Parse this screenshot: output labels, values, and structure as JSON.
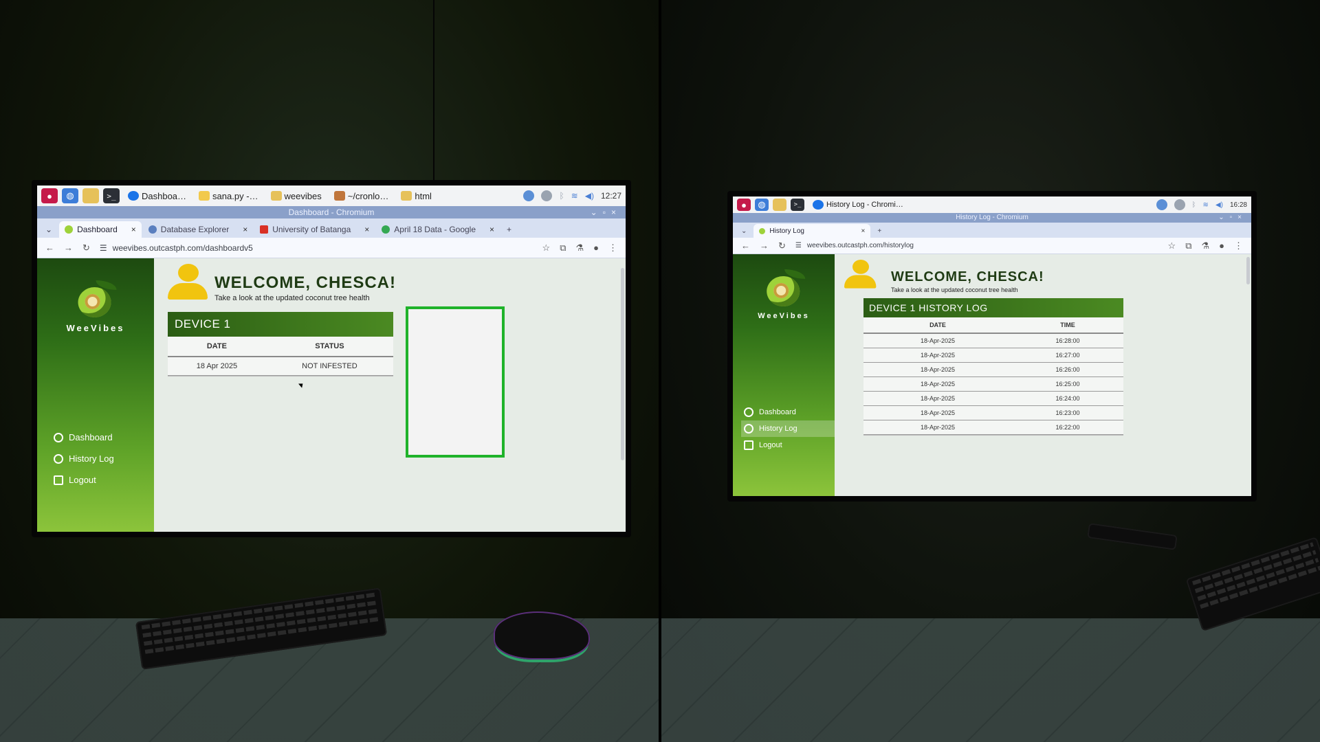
{
  "left": {
    "taskbar": {
      "tasks": [
        "Dashboa…",
        "sana.py -…",
        "weevibes",
        "~/cronlo…",
        "html"
      ],
      "clock": "12:27"
    },
    "window_title": "Dashboard - Chromium",
    "tabs": [
      {
        "label": "Dashboard",
        "active": true
      },
      {
        "label": "Database Explorer"
      },
      {
        "label": "University of Batanga"
      },
      {
        "label": "April 18 Data - Google"
      }
    ],
    "url": "weevibes.outcastph.com/dashboardv5",
    "app": {
      "logo": "WeeVibes",
      "nav": [
        "Dashboard",
        "History Log",
        "Logout"
      ],
      "welcome_title": "WELCOME, CHESCA!",
      "welcome_sub": "Take a look at the updated coconut tree health",
      "device_title": "DEVICE 1",
      "columns": [
        "DATE",
        "STATUS"
      ],
      "row": {
        "date": "18 Apr 2025",
        "status": "NOT INFESTED"
      }
    }
  },
  "right": {
    "taskbar": {
      "tasks": [
        "History Log - Chromi…"
      ],
      "clock": "16:28"
    },
    "window_title": "History Log - Chromium",
    "tabs": [
      {
        "label": "History Log",
        "active": true
      }
    ],
    "url": "weevibes.outcastph.com/historylog",
    "app": {
      "logo": "WeeVibes",
      "nav": [
        "Dashboard",
        "History Log",
        "Logout"
      ],
      "welcome_title": "WELCOME, CHESCA!",
      "welcome_sub": "Take a look at the updated coconut tree health",
      "history_title": "DEVICE 1 HISTORY LOG",
      "columns": [
        "DATE",
        "TIME"
      ],
      "rows": [
        {
          "date": "18-Apr-2025",
          "time": "16:28:00"
        },
        {
          "date": "18-Apr-2025",
          "time": "16:27:00"
        },
        {
          "date": "18-Apr-2025",
          "time": "16:26:00"
        },
        {
          "date": "18-Apr-2025",
          "time": "16:25:00"
        },
        {
          "date": "18-Apr-2025",
          "time": "16:24:00"
        },
        {
          "date": "18-Apr-2025",
          "time": "16:23:00"
        },
        {
          "date": "18-Apr-2025",
          "time": "16:22:00"
        }
      ]
    }
  }
}
